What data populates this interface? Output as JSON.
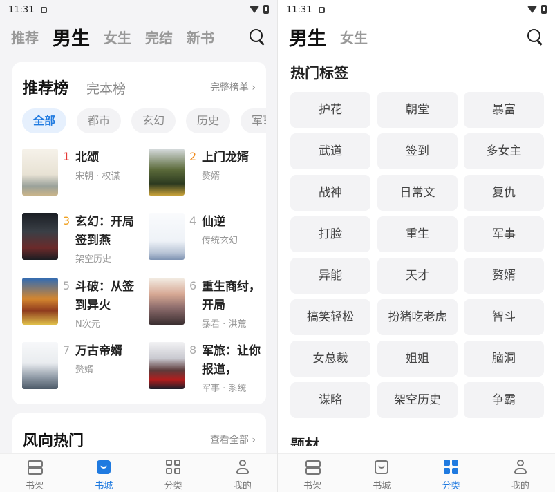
{
  "left": {
    "status_time": "11:31",
    "top_tabs": [
      {
        "label": "推荐",
        "active": false
      },
      {
        "label": "男生",
        "active": true
      },
      {
        "label": "女生",
        "active": false
      },
      {
        "label": "完结",
        "active": false
      },
      {
        "label": "新书",
        "active": false
      }
    ],
    "rank_card": {
      "title_active": "推荐榜",
      "title_other": "完本榜",
      "more": "完整榜单 ›",
      "chips": [
        "全部",
        "都市",
        "玄幻",
        "历史",
        "军事"
      ],
      "books": [
        {
          "rank": "1",
          "title": "北颂",
          "tags": "宋朝 · 权谋"
        },
        {
          "rank": "2",
          "title": "上门龙婿",
          "tags": "赘婿"
        },
        {
          "rank": "3",
          "title": "玄幻：开局签到燕",
          "tags": "架空历史"
        },
        {
          "rank": "4",
          "title": "仙逆",
          "tags": "传统玄幻"
        },
        {
          "rank": "5",
          "title": "斗破：从签到异火",
          "tags": "N次元"
        },
        {
          "rank": "6",
          "title": "重生商纣，开局",
          "tags": "暴君 · 洪荒"
        },
        {
          "rank": "7",
          "title": "万古帝婿",
          "tags": "赘婿"
        },
        {
          "rank": "8",
          "title": "军旅：让你报道，",
          "tags": "军事 · 系统"
        }
      ]
    },
    "trend_card": {
      "title": "风向热门",
      "more": "查看全部 ›"
    },
    "bottom_nav": [
      {
        "label": "书架",
        "icon": "bookshelf-icon",
        "active": false
      },
      {
        "label": "书城",
        "icon": "bookstore-icon",
        "active": true
      },
      {
        "label": "分类",
        "icon": "category-grid-icon",
        "active": false
      },
      {
        "label": "我的",
        "icon": "profile-icon",
        "active": false
      }
    ]
  },
  "right": {
    "status_time": "11:31",
    "top_tabs": [
      {
        "label": "男生",
        "active": true
      },
      {
        "label": "女生",
        "active": false
      }
    ],
    "hot_tags_title": "热门标签",
    "tags": [
      "护花",
      "朝堂",
      "暴富",
      "武道",
      "签到",
      "多女主",
      "战神",
      "日常文",
      "复仇",
      "打脸",
      "重生",
      "军事",
      "异能",
      "天才",
      "赘婿",
      "搞笑轻松",
      "扮猪吃老虎",
      "智斗",
      "女总裁",
      "姐姐",
      "脑洞",
      "谋略",
      "架空历史",
      "争霸"
    ],
    "next_section": "题材",
    "bottom_nav": [
      {
        "label": "书架",
        "icon": "bookshelf-icon",
        "active": false
      },
      {
        "label": "书城",
        "icon": "bookstore-icon",
        "active": false
      },
      {
        "label": "分类",
        "icon": "category-grid-icon",
        "active": true
      },
      {
        "label": "我的",
        "icon": "profile-icon",
        "active": false
      }
    ]
  },
  "colors": {
    "accent": "#1f7ae0",
    "rank1": "#e53935",
    "rank2": "#f08a1c",
    "rank3": "#f0a020"
  }
}
